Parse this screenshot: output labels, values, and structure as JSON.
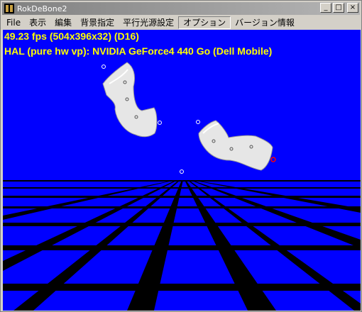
{
  "window": {
    "title": "RokDeBone2",
    "controls": {
      "minimize": "_",
      "maximize": "□",
      "close": "×"
    }
  },
  "menu": {
    "items": [
      {
        "label": "File"
      },
      {
        "label": "表示"
      },
      {
        "label": "編集"
      },
      {
        "label": "背景指定"
      },
      {
        "label": "平行光源設定"
      },
      {
        "label": "オプション"
      },
      {
        "label": "バージョン情報"
      }
    ],
    "active_index": 5
  },
  "viewport": {
    "fps_line": "49.23 fps (504x396x32) (D16)",
    "device_line": "HAL (pure hw vp): NVIDIA GeForce4 440 Go (Dell Mobile)",
    "colors": {
      "background": "#0000ff",
      "grid": "#000000",
      "text": "#ffff00",
      "mesh": "#e8e8e8",
      "selected_joint": "#ff0000"
    }
  }
}
